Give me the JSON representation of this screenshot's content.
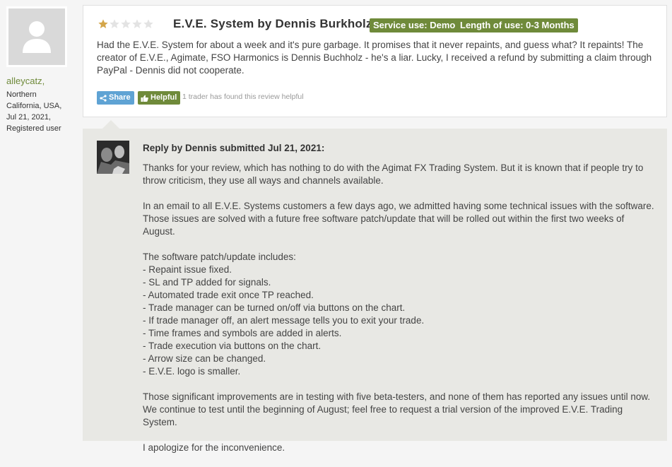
{
  "user": {
    "name": "alleycatz,",
    "location_line1": "Northern",
    "location_line2": "California, USA,",
    "date": "Jul 21, 2021,",
    "role": "Registered user",
    "avatar_icon": "user-silhouette-icon"
  },
  "review": {
    "rating": 1,
    "rating_max": 5,
    "star_color": "#d4a64a",
    "title": "E.V.E. System by Dennis Burkholz",
    "badges": [
      "Service use: Demo",
      "Length of use: 0-3 Months"
    ],
    "badge_color": "#6f8a3a",
    "body": "Had the E.V.E. System for about a week and it's pure garbage. It promises that it never repaints, and guess what? It repaints! The creator of E.V.E., Agimate, FSO Harmonics is Dennis Buchholz - he's a liar. Lucky, I received a refund by submitting a claim through PayPal - Dennis did not cooperate.",
    "share_label": "Share",
    "share_icon": "share-icon",
    "helpful_label": "Helpful",
    "helpful_icon": "thumbs-up-icon",
    "helpful_note": "1 trader has found this review helpful"
  },
  "reply": {
    "heading": "Reply by Dennis submitted Jul 21, 2021:",
    "paragraph1": "Thanks for your review, which has nothing to do with the Agimat FX Trading System. But it is known that if people try to throw criticism, they use all ways and channels available.",
    "paragraph2": "In an email to all E.V.E. Systems customers a few days ago, we admitted having some technical issues with the software. Those issues are solved with a future free software patch/update that will be rolled out within the first two weeks of August.",
    "list_intro": "The software patch/update includes:",
    "items": [
      "- Repaint issue fixed.",
      "- SL and TP added for signals.",
      "- Automated trade exit once TP reached.",
      "- Trade manager can be turned on/off via buttons on the chart.",
      "- If trade manager off, an alert message tells you to exit your trade.",
      "- Time frames and symbols are added in alerts.",
      "- Trade execution via buttons on the chart.",
      "- Arrow size can be changed.",
      "- E.V.E. logo is smaller."
    ],
    "paragraph3": "Those significant improvements are in testing with five beta-testers, and none of them has reported any issues until now. We continue to test until the beginning of August; feel free to request a trial version of the improved E.V.E. Trading System.",
    "paragraph4": "I apologize for the inconvenience."
  }
}
